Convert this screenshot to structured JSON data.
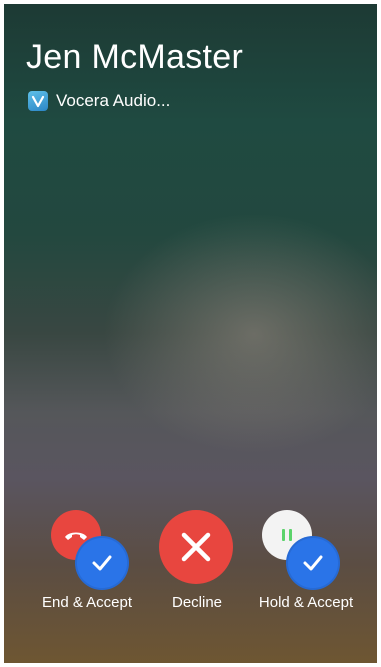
{
  "call": {
    "caller_name": "Jen McMaster",
    "app_name": "Vocera Audio..."
  },
  "actions": {
    "end_accept": {
      "label": "End & Accept",
      "icons": [
        "phone-hangup-icon",
        "checkmark-icon"
      ]
    },
    "decline": {
      "label": "Decline",
      "icon": "x-icon"
    },
    "hold_accept": {
      "label": "Hold & Accept",
      "icons": [
        "pause-icon",
        "checkmark-icon"
      ]
    }
  },
  "colors": {
    "decline_red": "#e8463f",
    "accept_blue": "#2a74e8",
    "hold_green": "#5bd36b",
    "hold_white": "#f3f3f3"
  }
}
